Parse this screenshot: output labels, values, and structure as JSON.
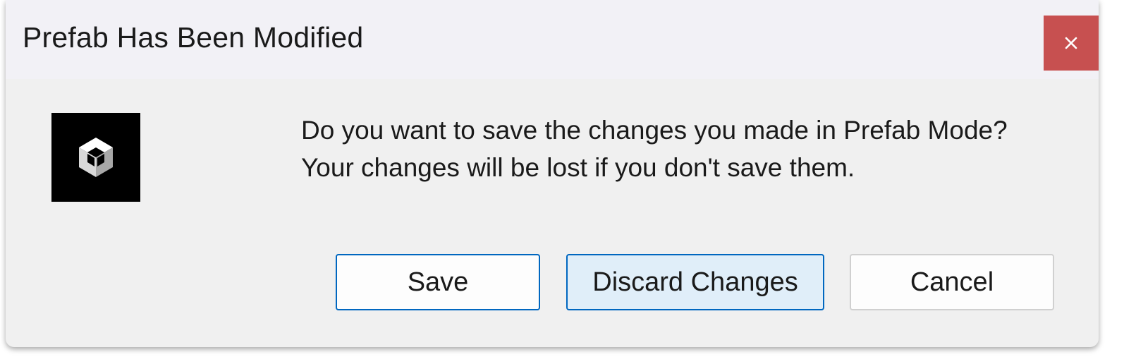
{
  "window": {
    "title": "Prefab Has Been Modified",
    "close_icon": "close-icon"
  },
  "app_icon": "unity-logo-icon",
  "message": "Do you want to save the changes you made in Prefab Mode? Your changes will be lost if you don't save them.",
  "buttons": {
    "save": "Save",
    "discard": "Discard Changes",
    "cancel": "Cancel"
  },
  "colors": {
    "close_button_bg": "#c75050",
    "accent_border": "#0067c0",
    "focused_button_bg": "#e0eef9"
  }
}
